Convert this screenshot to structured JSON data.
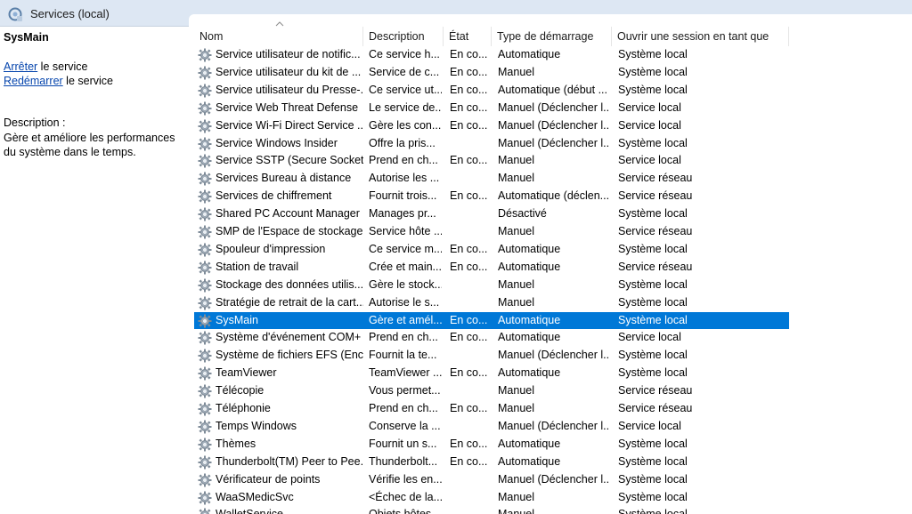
{
  "window": {
    "title": "Services (local)"
  },
  "left_pane": {
    "service_name": "SysMain",
    "action1": {
      "link": "Arrêter",
      "rest": " le service"
    },
    "action2": {
      "link": "Redémarrer",
      "rest": " le service"
    },
    "description_label": "Description :",
    "description": "Gère et améliore les performances du système dans le temps."
  },
  "columns": [
    "Nom",
    "Description",
    "État",
    "Type de démarrage",
    "Ouvrir une session en tant que"
  ],
  "rows": [
    {
      "name": "Service utilisateur de notific...",
      "desc": "Ce service h...",
      "state": "En co...",
      "start": "Automatique",
      "logon": "Système local"
    },
    {
      "name": "Service utilisateur du kit de ...",
      "desc": "Service de c...",
      "state": "En co...",
      "start": "Manuel",
      "logon": "Système local"
    },
    {
      "name": "Service utilisateur du Presse-...",
      "desc": "Ce service ut...",
      "state": "En co...",
      "start": "Automatique (début ...",
      "logon": "Système local"
    },
    {
      "name": "Service Web Threat Defense",
      "desc": "Le service de...",
      "state": "En co...",
      "start": "Manuel (Déclencher l...",
      "logon": "Service local"
    },
    {
      "name": "Service Wi-Fi Direct Service ...",
      "desc": "Gère les con...",
      "state": "En co...",
      "start": "Manuel (Déclencher l...",
      "logon": "Service local"
    },
    {
      "name": "Service Windows Insider",
      "desc": "Offre la pris...",
      "state": "",
      "start": "Manuel (Déclencher l...",
      "logon": "Système local"
    },
    {
      "name": "Service SSTP (Secure Socket ...",
      "desc": "Prend en ch...",
      "state": "En co...",
      "start": "Manuel",
      "logon": "Service local"
    },
    {
      "name": "Services Bureau à distance",
      "desc": "Autorise les ...",
      "state": "",
      "start": "Manuel",
      "logon": "Service réseau"
    },
    {
      "name": "Services de chiffrement",
      "desc": "Fournit trois...",
      "state": "En co...",
      "start": "Automatique (déclen...",
      "logon": "Service réseau"
    },
    {
      "name": "Shared PC Account Manager",
      "desc": "Manages pr...",
      "state": "",
      "start": "Désactivé",
      "logon": "Système local"
    },
    {
      "name": "SMP de l'Espace de stockage...",
      "desc": "Service hôte ...",
      "state": "",
      "start": "Manuel",
      "logon": "Service réseau"
    },
    {
      "name": "Spouleur d'impression",
      "desc": "Ce service m...",
      "state": "En co...",
      "start": "Automatique",
      "logon": "Système local"
    },
    {
      "name": "Station de travail",
      "desc": "Crée et main...",
      "state": "En co...",
      "start": "Automatique",
      "logon": "Service réseau"
    },
    {
      "name": "Stockage des données utilis...",
      "desc": "Gère le stock...",
      "state": "",
      "start": "Manuel",
      "logon": "Système local"
    },
    {
      "name": "Stratégie de retrait de la cart...",
      "desc": "Autorise le s...",
      "state": "",
      "start": "Manuel",
      "logon": "Système local"
    },
    {
      "name": "SysMain",
      "desc": "Gère et amél...",
      "state": "En co...",
      "start": "Automatique",
      "logon": "Système local",
      "selected": true
    },
    {
      "name": "Système d'événement COM+",
      "desc": "Prend en ch...",
      "state": "En co...",
      "start": "Automatique",
      "logon": "Service local"
    },
    {
      "name": "Système de fichiers EFS (Encr...",
      "desc": "Fournit la te...",
      "state": "",
      "start": "Manuel (Déclencher l...",
      "logon": "Système local"
    },
    {
      "name": "TeamViewer",
      "desc": "TeamViewer ...",
      "state": "En co...",
      "start": "Automatique",
      "logon": "Système local"
    },
    {
      "name": "Télécopie",
      "desc": "Vous permet...",
      "state": "",
      "start": "Manuel",
      "logon": "Service réseau"
    },
    {
      "name": "Téléphonie",
      "desc": "Prend en ch...",
      "state": "En co...",
      "start": "Manuel",
      "logon": "Service réseau"
    },
    {
      "name": "Temps Windows",
      "desc": "Conserve la ...",
      "state": "",
      "start": "Manuel (Déclencher l...",
      "logon": "Service local"
    },
    {
      "name": "Thèmes",
      "desc": "Fournit un s...",
      "state": "En co...",
      "start": "Automatique",
      "logon": "Système local"
    },
    {
      "name": "Thunderbolt(TM) Peer to Pee...",
      "desc": "Thunderbolt...",
      "state": "En co...",
      "start": "Automatique",
      "logon": "Système local"
    },
    {
      "name": "Vérificateur de points",
      "desc": "Vérifie les en...",
      "state": "",
      "start": "Manuel (Déclencher l...",
      "logon": "Système local"
    },
    {
      "name": "WaaSMedicSvc",
      "desc": "<Échec de la...",
      "state": "",
      "start": "Manuel",
      "logon": "Système local"
    },
    {
      "name": "WalletService",
      "desc": "Objets hôtes...",
      "state": "",
      "start": "Manuel",
      "logon": "Système local"
    }
  ],
  "icons": {
    "title": "services-icon",
    "row": "gear-icon"
  },
  "colors": {
    "selection": "#0078d7",
    "link": "#0645ad",
    "titlebar": "#dde7f3"
  }
}
